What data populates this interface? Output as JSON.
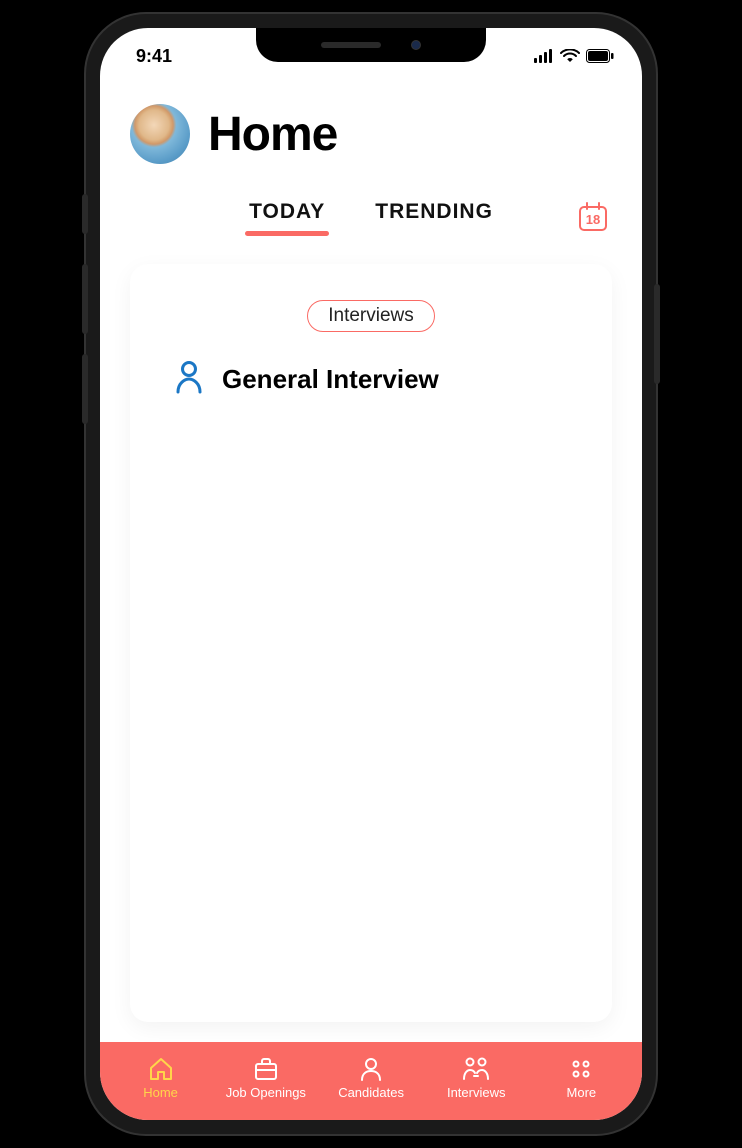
{
  "statusbar": {
    "time": "9:41"
  },
  "header": {
    "title": "Home"
  },
  "tabs": {
    "items": [
      {
        "label": "TODAY"
      },
      {
        "label": "TRENDING"
      }
    ],
    "calendar_day": "18"
  },
  "card": {
    "pill_label": "Interviews",
    "item_title": "General Interview"
  },
  "bottomnav": {
    "items": [
      {
        "label": "Home"
      },
      {
        "label": "Job Openings"
      },
      {
        "label": "Candidates"
      },
      {
        "label": "Interviews"
      },
      {
        "label": "More"
      }
    ]
  },
  "colors": {
    "accent": "#fa6a64",
    "nav_active": "#ffd54a",
    "link_blue": "#1b77c5"
  }
}
